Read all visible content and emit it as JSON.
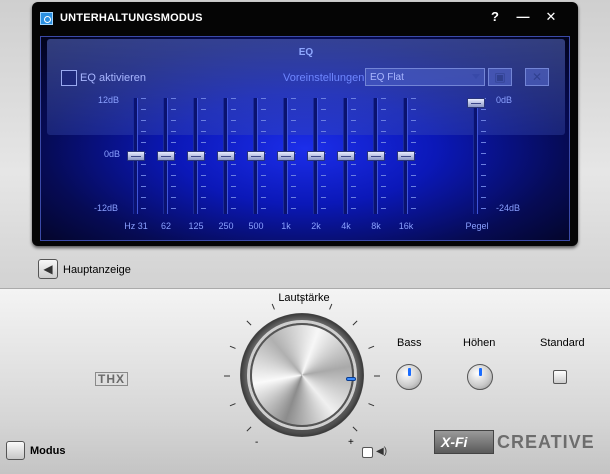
{
  "window": {
    "title": "UNTERHALTUNGSMODUS",
    "help_label": "?",
    "minimize_label": "—",
    "close_label": "✕"
  },
  "eq": {
    "title": "EQ",
    "enable_label": "EQ aktivieren",
    "enabled": false,
    "presets_label": "Voreinstellungen",
    "preset_value": "EQ Flat",
    "db_top": "12dB",
    "db_mid": "0dB",
    "db_bottom": "-12dB",
    "bands": [
      {
        "label": "Hz 31",
        "gain_db": 0
      },
      {
        "label": "62",
        "gain_db": 0
      },
      {
        "label": "125",
        "gain_db": 0
      },
      {
        "label": "250",
        "gain_db": 0
      },
      {
        "label": "500",
        "gain_db": 0
      },
      {
        "label": "1k",
        "gain_db": 0
      },
      {
        "label": "2k",
        "gain_db": 0
      },
      {
        "label": "4k",
        "gain_db": 0
      },
      {
        "label": "8k",
        "gain_db": 0
      },
      {
        "label": "16k",
        "gain_db": 0
      }
    ],
    "level": {
      "label": "Pegel",
      "top": "0dB",
      "bottom": "-24dB",
      "value_db": 0
    }
  },
  "nav": {
    "back_label": "Hauptanzeige"
  },
  "controls": {
    "volume_label": "Lautstärke",
    "bass_label": "Bass",
    "treble_label": "Höhen",
    "standard_label": "Standard",
    "knob_minus": "-",
    "knob_plus": "+",
    "mode_label": "Modus"
  },
  "branding": {
    "thx": "THX",
    "xfi": "X-Fi",
    "creative": "CREATIVE"
  },
  "colors": {
    "accent": "#1a6cff",
    "eq_bg": "#0b18b8"
  }
}
